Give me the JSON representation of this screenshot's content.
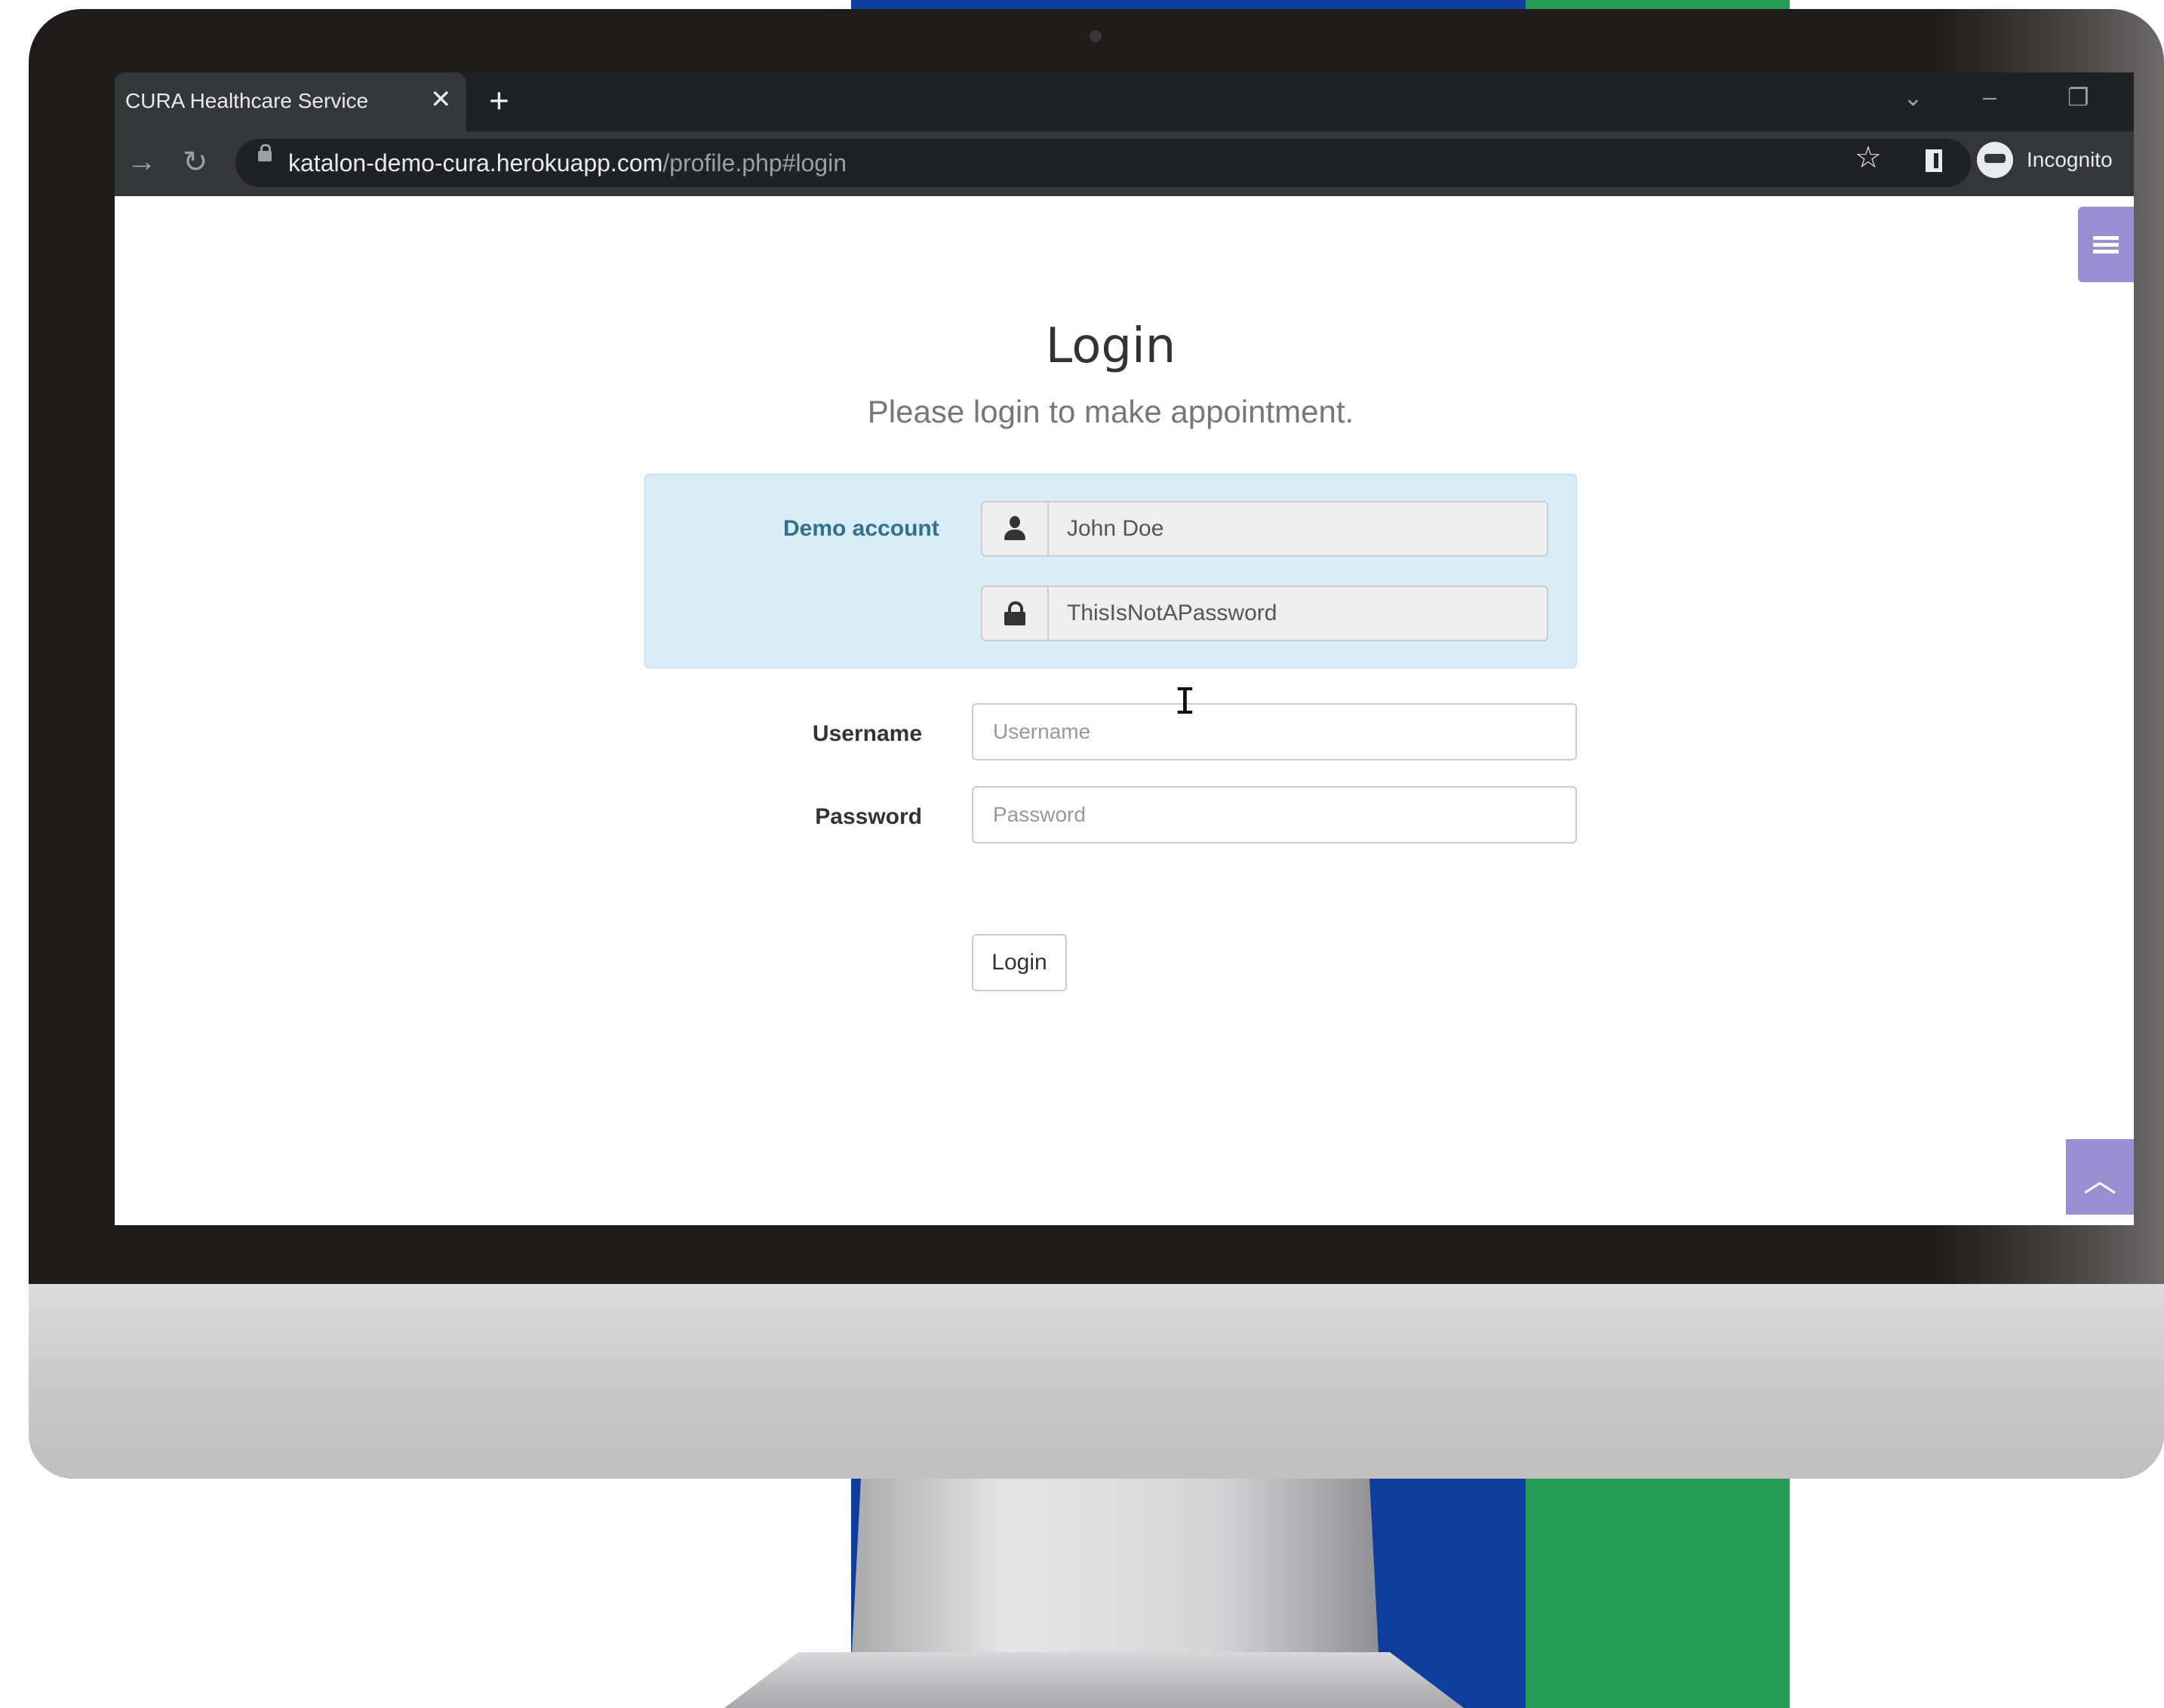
{
  "browser": {
    "tab_title": "CURA Healthcare Service",
    "tab_close_glyph": "✕",
    "new_tab_glyph": "+",
    "url_host": "katalon-demo-cura.herokuapp.com",
    "url_path": "/profile.php#login",
    "profile_label": "Incognito",
    "icons": [
      "back-icon",
      "forward-icon",
      "reload-icon",
      "lock-icon",
      "star-icon",
      "side-panel-icon",
      "incognito-icon",
      "tab-search-icon",
      "minimize-icon",
      "restore-icon"
    ]
  },
  "page": {
    "title": "Login",
    "subtitle": "Please login to make appointment.",
    "demo": {
      "label": "Demo account",
      "username": "John Doe",
      "password": "ThisIsNotAPassword"
    },
    "form": {
      "username_label": "Username",
      "username_placeholder": "Username",
      "username_value": "",
      "password_label": "Password",
      "password_placeholder": "Password",
      "password_value": "",
      "login_button": "Login"
    },
    "colors": {
      "accent": "#9a8fd0",
      "demo_bg": "#d9edf7",
      "demo_text": "#31708f",
      "backdrop_blue": "#0f3d9d",
      "backdrop_green": "#249c55"
    }
  }
}
